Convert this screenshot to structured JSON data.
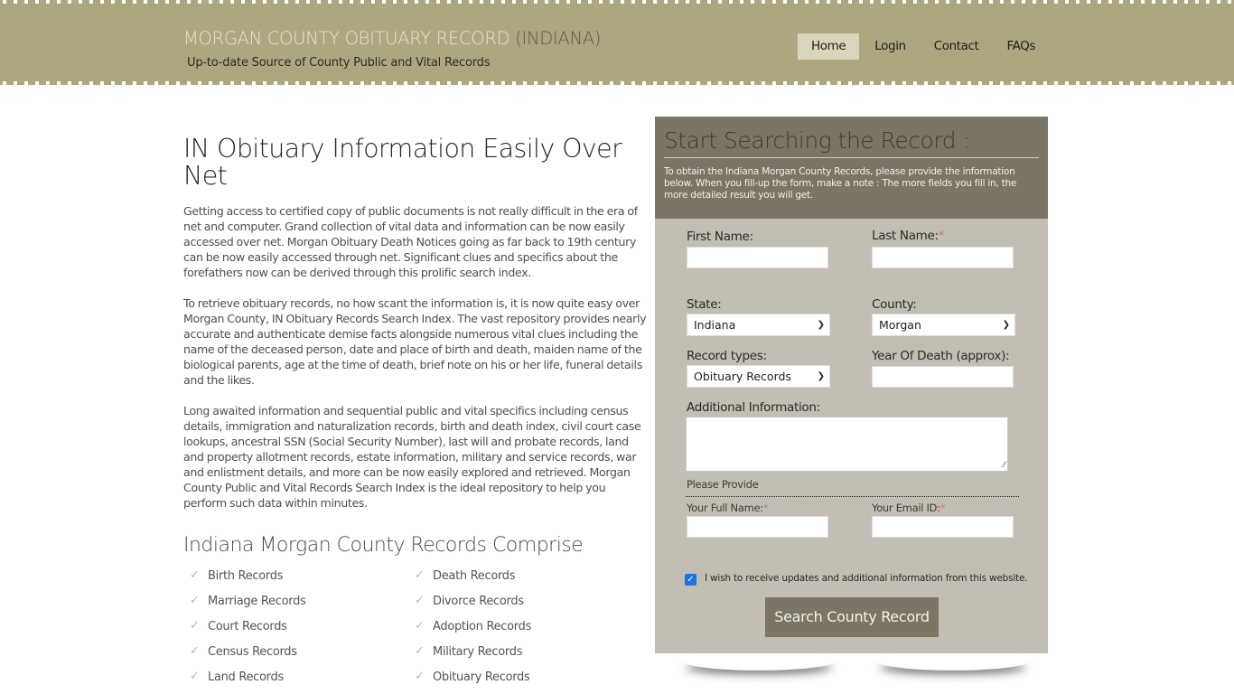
{
  "header": {
    "title_main": "MORGAN COUNTY OBITUARY RECORD",
    "title_state": "(INDIANA)",
    "tagline": "Up-to-date Source of  County Public and Vital Records"
  },
  "nav": {
    "items": [
      {
        "label": "Home",
        "active": true
      },
      {
        "label": "Login",
        "active": false
      },
      {
        "label": "Contact",
        "active": false
      },
      {
        "label": "FAQs",
        "active": false
      }
    ]
  },
  "main": {
    "heading": "IN Obituary Information Easily Over Net",
    "paragraphs": [
      "Getting access to certified copy of public documents is not really difficult in the era of net and computer. Grand collection of vital data and information can be now easily accessed over net. Morgan Obituary Death Notices going as far back to 19th century can be now easily accessed through net. Significant clues and specifics about the forefathers now can be derived through this prolific search index.",
      "To retrieve obituary records, no how scant the information is, it is now quite easy over Morgan County, IN Obituary Records Search Index. The vast repository provides nearly accurate and authenticate demise facts alongside numerous vital clues including the name of the deceased person, date and place of birth and death, maiden name of the biological parents, age at the time of death, brief note on his or her life, funeral details and the likes.",
      "Long awaited information and sequential public and vital specifics including census details, immigration and naturalization records, birth and death index, civil court case lookups, ancestral SSN (Social Security Number), last will and probate records, land and property allotment records, estate information, military and service records, war and enlistment details, and more can be now easily explored and retrieved. Morgan County Public and Vital Records Search Index is the ideal repository to help you perform such data within minutes."
    ],
    "records_heading": "Indiana Morgan County Records Comprise",
    "records": [
      "Birth Records",
      "Death Records",
      "Marriage Records",
      "Divorce Records",
      "Court Records",
      "Adoption Records",
      "Census Records",
      "Military Records",
      "Land Records",
      "Obituary Records"
    ],
    "check_icon": "checkmark-icon"
  },
  "form": {
    "title": "Start Searching the Record :",
    "description": "To obtain the Indiana Morgan County Records, please provide the information below. When you fill-up the form, make a note : The more fields you fill in, the more detailed result you will get.",
    "first_name_label": "First Name:",
    "first_name_value": "",
    "last_name_label": "Last Name:",
    "last_name_value": "",
    "required_mark": "*",
    "state_label": "State:",
    "state_value": "Indiana",
    "county_label": "County:",
    "county_value": "Morgan",
    "record_types_label": "Record types:",
    "record_types_value": "Obituary Records",
    "year_label": "Year Of Death (approx):",
    "year_value": "",
    "additional_label": "Additional Information:",
    "additional_value": "",
    "please_provide": "Please Provide",
    "full_name_label": "Your Full Name:",
    "full_name_value": "",
    "email_label": "Your Email ID:",
    "email_value": "",
    "updates_checked": true,
    "updates_label": "I wish to receive updates and additional information from this website.",
    "submit_label": "Search County Record"
  },
  "colors": {
    "header_bg": "#ada780",
    "panel_head_bg": "#7b7566",
    "panel_bg": "#c2beb3",
    "button_bg": "#7b7566",
    "nav_active_bg": "#d9d5bd",
    "required": "#e26b6b"
  }
}
